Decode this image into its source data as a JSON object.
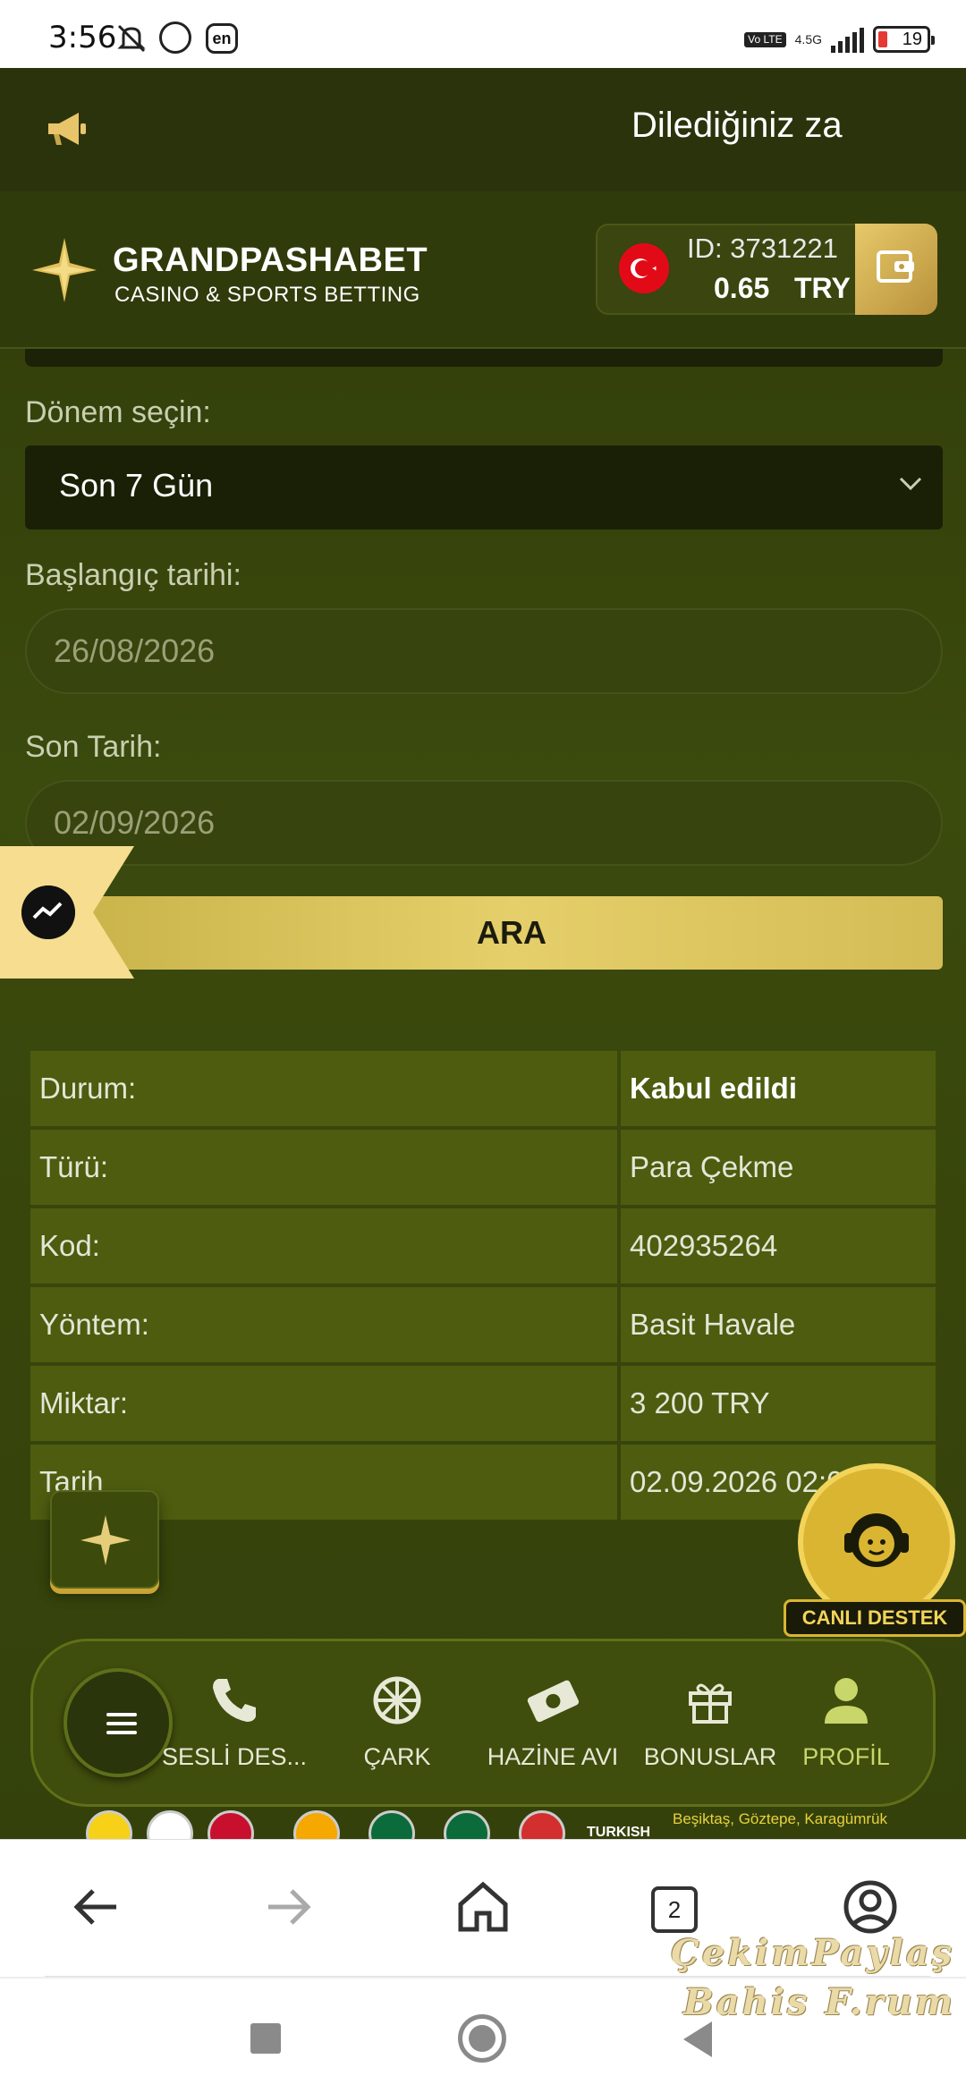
{
  "status_bar": {
    "time": "3:56",
    "lang_badge": "en",
    "volte": "Vo LTE",
    "network": "4.5G",
    "battery": "19"
  },
  "marquee": {
    "text": "Dilediğiniz za"
  },
  "header": {
    "brand": "GRANDPASHABET",
    "brand_sub": "CASINO & SPORTS BETTING",
    "account_id": "ID: 3731221",
    "balance": "0.65",
    "currency": "TRY"
  },
  "form": {
    "period_label": "Dönem seçin:",
    "period_value": "Son 7 Gün",
    "start_label": "Başlangıç tarihi:",
    "start_value": "26/08/2026",
    "end_label": "Son Tarih:",
    "end_value": "02/09/2026",
    "search_button": "ARA"
  },
  "details": [
    {
      "key": "Durum:",
      "value": "Kabul edildi"
    },
    {
      "key": "Türü:",
      "value": "Para Çekme"
    },
    {
      "key": "Kod:",
      "value": "402935264"
    },
    {
      "key": "Yöntem:",
      "value": "Basit Havale"
    },
    {
      "key": "Miktar:",
      "value": "3 200 TRY"
    },
    {
      "key": "Tarih",
      "value": "02.09.2026 02:07"
    }
  ],
  "live_support": {
    "label": "CANLI DESTEK"
  },
  "bottom_nav": {
    "items": [
      {
        "label": "SESLİ DES...",
        "icon": "phone-icon"
      },
      {
        "label": "ÇARK",
        "icon": "wheel-icon"
      },
      {
        "label": "HAZİNE AVI",
        "icon": "money-icon"
      },
      {
        "label": "BONUSLAR",
        "icon": "gift-icon"
      },
      {
        "label": "PROFİL",
        "icon": "user-icon"
      }
    ]
  },
  "sponsors": {
    "text": "Beşiktaş, Göztepe, Karagümrük",
    "brand": "TURKISH"
  },
  "browser": {
    "tab_count": "2"
  },
  "watermark": {
    "line1": "ÇekimPaylaş",
    "line2": "Bahis F.rum"
  },
  "colors": {
    "accent_gold": "#d9b531",
    "background": "#34410b",
    "active_nav": "#c8d66a"
  }
}
